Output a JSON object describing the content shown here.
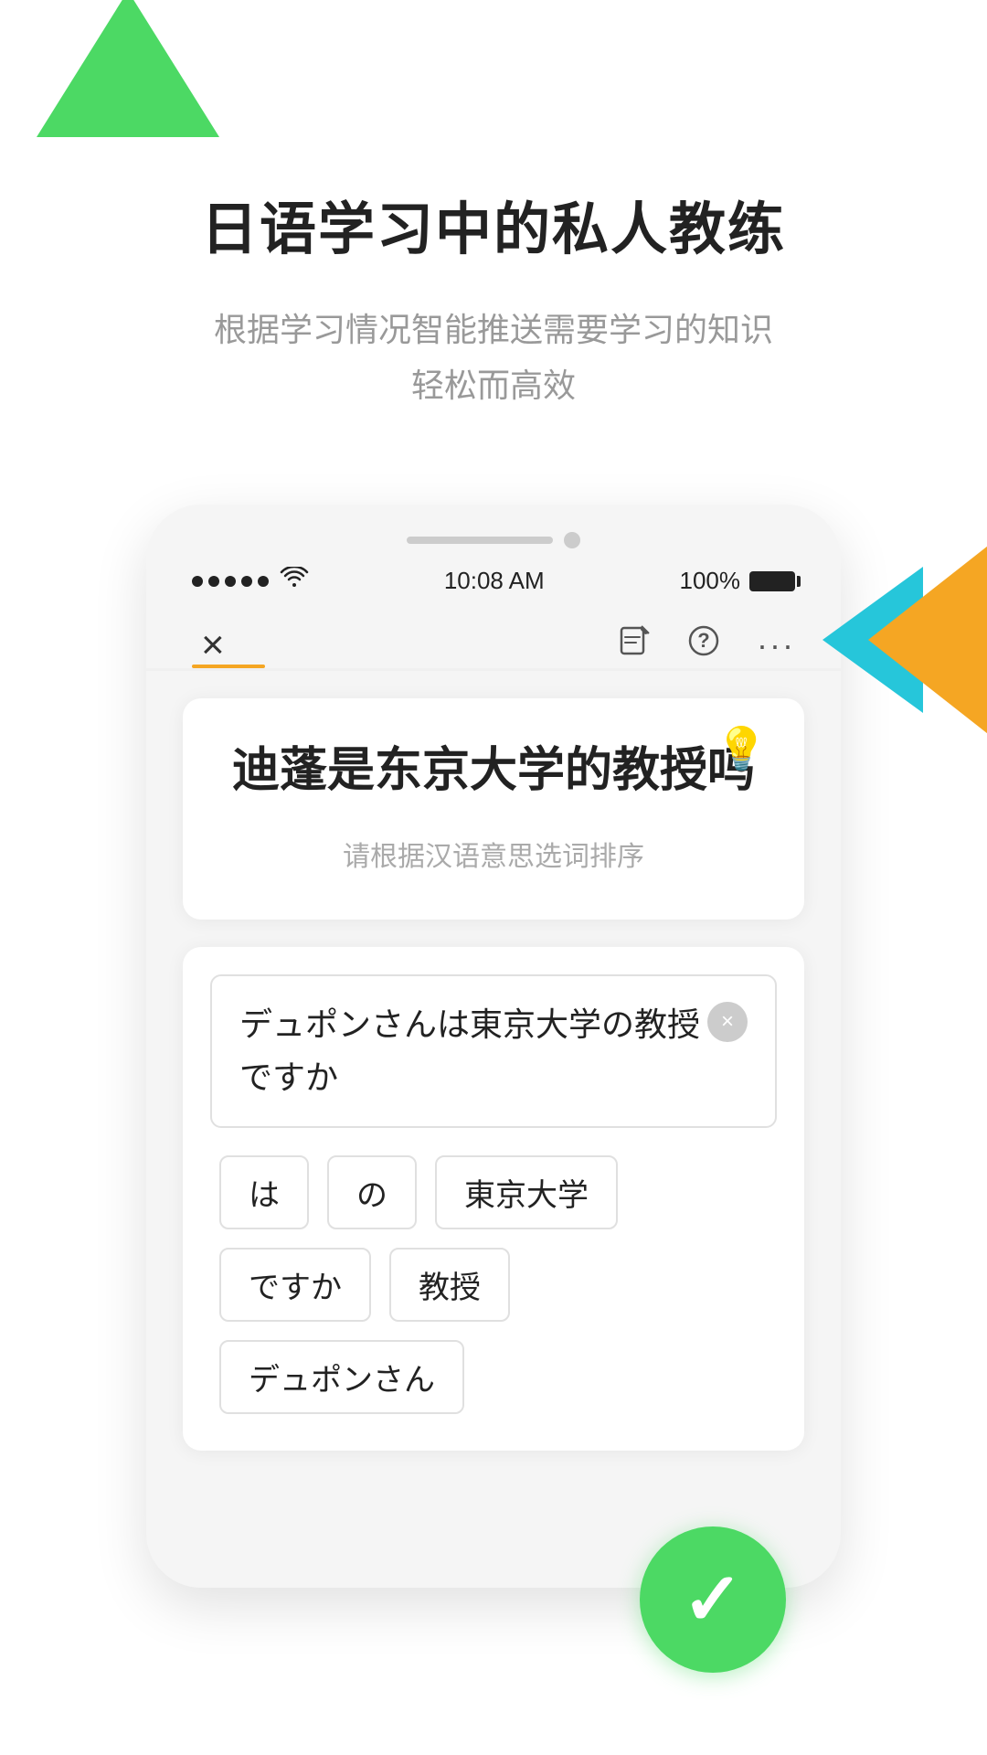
{
  "app": {
    "title": "日语学习中的私人教练",
    "subtitle_line1": "根据学习情况智能推送需要学习的知识",
    "subtitle_line2": "轻松而高效"
  },
  "status_bar": {
    "signal_dots": 5,
    "wifi": "📶",
    "time": "10:08 AM",
    "battery_percent": "100%"
  },
  "navbar": {
    "close_label": "×",
    "icons": [
      "📝",
      "?",
      "···"
    ]
  },
  "question_card": {
    "hint_icon": "💡",
    "question_text": "迪蓬是东京大学的教授吗",
    "instruction": "请根据汉语意思选词排序"
  },
  "answer_area": {
    "input_text": "デュポンさんは東京大学の教授ですか",
    "clear_icon": "×",
    "word_chips": [
      {
        "id": "chip1",
        "text": "は"
      },
      {
        "id": "chip2",
        "text": "の"
      },
      {
        "id": "chip3",
        "text": "東京大学"
      },
      {
        "id": "chip4",
        "text": "ですか"
      },
      {
        "id": "chip5",
        "text": "教授"
      },
      {
        "id": "chip6",
        "text": "デュポンさん"
      }
    ]
  },
  "check_button": {
    "icon": "✓"
  },
  "colors": {
    "green": "#4cd964",
    "orange": "#f5a623",
    "teal": "#00bcd4",
    "text_primary": "#222222",
    "text_secondary": "#999999"
  }
}
